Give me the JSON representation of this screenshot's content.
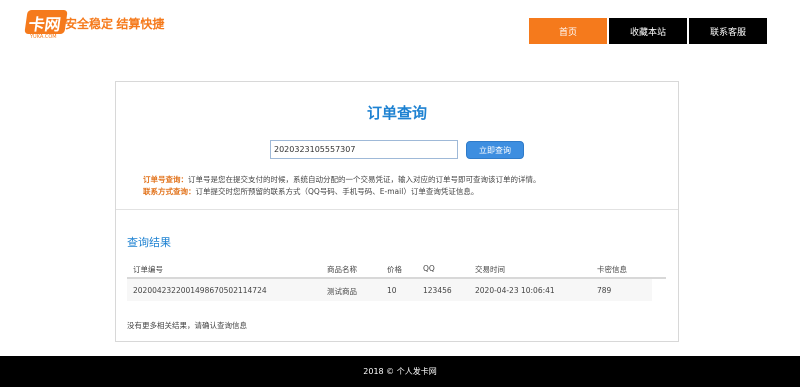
{
  "header": {
    "logo_text": "卡网",
    "logo_sub": "YUKA.COM",
    "slogan": "安全稳定 结算快捷",
    "nav": [
      {
        "label": "首页",
        "active": true
      },
      {
        "label": "收藏本站",
        "active": false
      },
      {
        "label": "联系客服",
        "active": false
      }
    ]
  },
  "query": {
    "title": "订单查询",
    "input_value": "2020323105557307",
    "button_label": "立即查询",
    "hint1_label": "订单号查询：",
    "hint1_text": "订单号是您在提交支付的时候，系统自动分配的一个交易凭证，输入对应的订单号即可查询该订单的详情。",
    "hint2_label": "联系方式查询：",
    "hint2_text": "订单提交时您所预留的联系方式（QQ号码、手机号码、E-mail）订单查询凭证信息。"
  },
  "results": {
    "title": "查询结果",
    "columns": [
      "订单编号",
      "商品名称",
      "价格",
      "QQ",
      "交易时间",
      "卡密信息"
    ],
    "rows": [
      [
        "20200423220014986705021147​24",
        "测试商品",
        "10",
        "123456",
        "2020-04-23 10:06:41",
        "789"
      ]
    ],
    "no_more": "没有更多相关结果，请确认查询信息"
  },
  "footer": {
    "text": "2018 © 个人发卡网"
  }
}
